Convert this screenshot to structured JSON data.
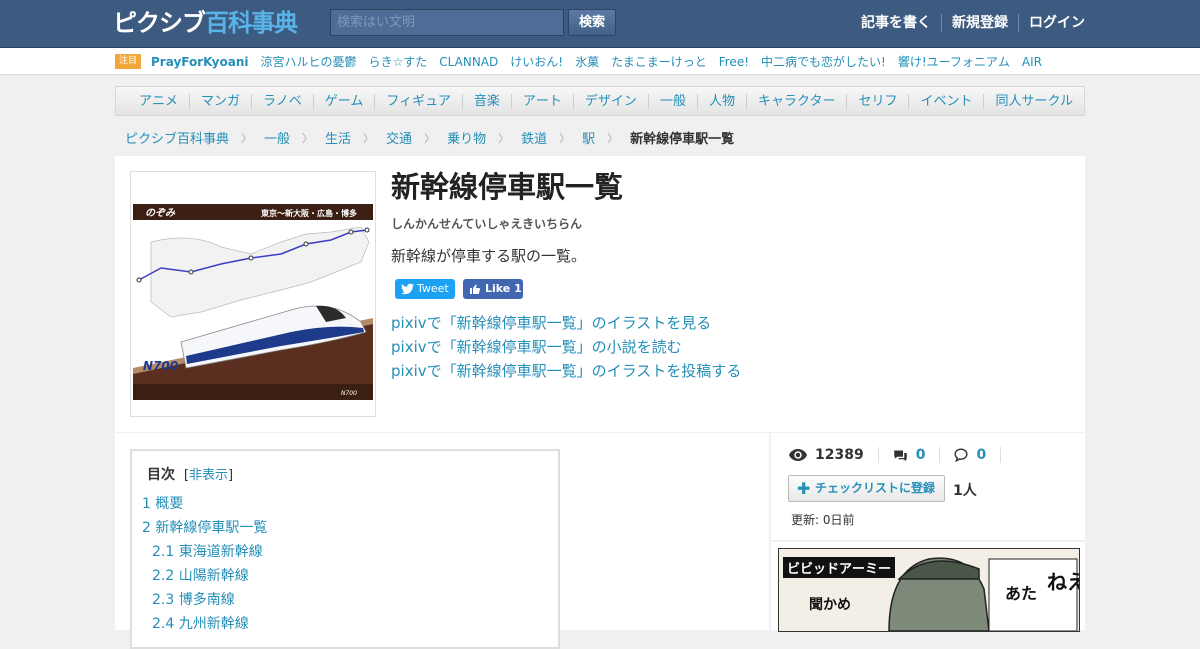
{
  "header": {
    "logo_part1": "ピクシブ",
    "logo_part2": "百科事典",
    "search_placeholder": "検索はい文明",
    "search_button": "検索",
    "nav": [
      "記事を書く",
      "新規登録",
      "ログイン"
    ]
  },
  "trending": {
    "badge": "注目",
    "items": [
      "PrayForKyoani",
      "涼宮ハルヒの憂鬱",
      "らき☆すた",
      "CLANNAD",
      "けいおん!",
      "氷菓",
      "たまこまーけっと",
      "Free!",
      "中二病でも恋がしたい!",
      "響け!ユーフォニアム",
      "AIR"
    ]
  },
  "categories": [
    "アニメ",
    "マンガ",
    "ラノベ",
    "ゲーム",
    "フィギュア",
    "音楽",
    "アート",
    "デザイン",
    "一般",
    "人物",
    "キャラクター",
    "セリフ",
    "イベント",
    "同人サークル"
  ],
  "breadcrumb": {
    "items": [
      "ピクシブ百科事典",
      "一般",
      "生活",
      "交通",
      "乗り物",
      "鉄道",
      "駅"
    ],
    "current": "新幹線停車駅一覧"
  },
  "article": {
    "title": "新幹線停車駅一覧",
    "reading": "しんかんせんていしゃえきいちらん",
    "description": "新幹線が停車する駅の一覧。",
    "tweet_label": "Tweet",
    "like_label": "Like 1",
    "pixiv_links": [
      "pixivで「新幹線停車駅一覧」のイラストを見る",
      "pixivで「新幹線停車駅一覧」の小説を読む",
      "pixivで「新幹線停車駅一覧」のイラストを投稿する"
    ],
    "image": {
      "train_name": "のぞみ",
      "route": "東京～新大阪・広島・博多",
      "model": "N700",
      "caption": "N700"
    }
  },
  "toc": {
    "title": "目次",
    "toggle_open": "[",
    "toggle": "非表示",
    "toggle_close": "]",
    "items": [
      {
        "label": "1 概要",
        "level": 1
      },
      {
        "label": "2 新幹線停車駅一覧",
        "level": 1
      },
      {
        "label": "2.1 東海道新幹線",
        "level": 2
      },
      {
        "label": "2.2 山陽新幹線",
        "level": 2
      },
      {
        "label": "2.3 博多南線",
        "level": 2
      },
      {
        "label": "2.4 九州新幹線",
        "level": 2
      }
    ]
  },
  "sidebar": {
    "views": "12389",
    "comments": "0",
    "replies": "0",
    "checklist_button": "チェックリストに登録",
    "checklist_count": "1人",
    "updated": "更新: 0日前",
    "ad_title": "ビビッドアーミー"
  },
  "colors": {
    "header_bg": "#3d5a80",
    "link": "#258fb8",
    "logo_accent": "#58b3e8",
    "badge": "#f3a63a",
    "tweet": "#1da1f2",
    "like": "#4267b2"
  }
}
